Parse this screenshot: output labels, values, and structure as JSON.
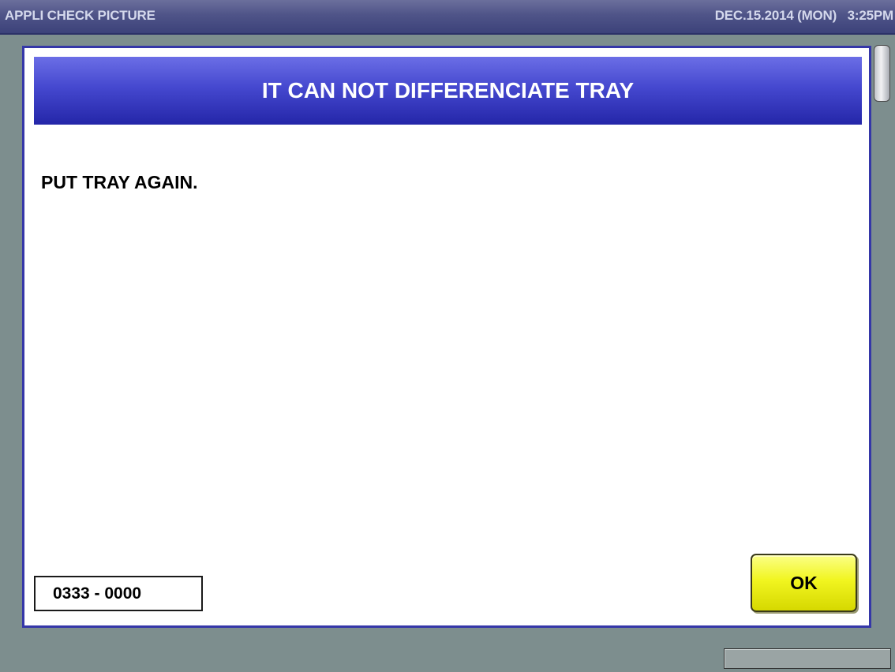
{
  "header": {
    "app_title": "APPLI CHECK PICTURE",
    "datetime": "DEC.15.2014 (MON)   3:25PM"
  },
  "dialog": {
    "title": "IT CAN NOT DIFFERENCIATE TRAY",
    "message": "PUT TRAY AGAIN.",
    "error_code": "0333 - 0000",
    "ok_label": "OK"
  },
  "colors": {
    "header_bar": "#4f5488",
    "dialog_title_bg": "#4548cf",
    "dialog_border": "#3537a8",
    "ok_button": "#f1f520",
    "background": "#7d8e8e"
  }
}
